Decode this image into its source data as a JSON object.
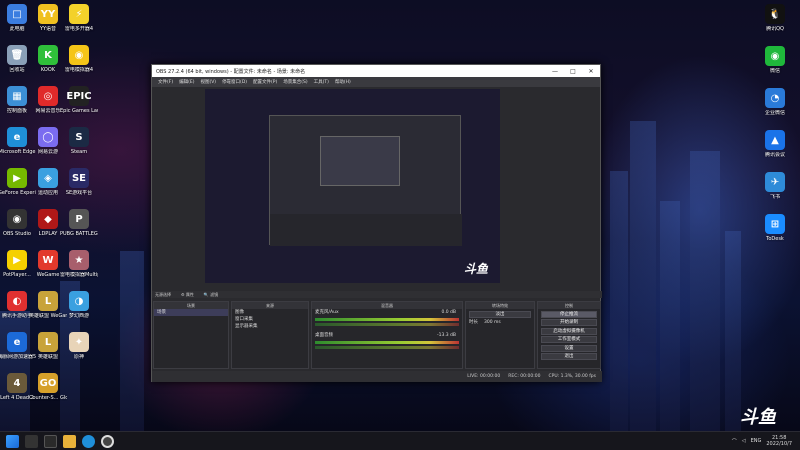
{
  "desktop_left": [
    {
      "name": "this-pc-icon",
      "label": "此电脑",
      "color": "#3b7de0",
      "glyph": "□"
    },
    {
      "name": "yy-voice-icon",
      "label": "YY语音",
      "color": "#f0c020",
      "glyph": "YY"
    },
    {
      "name": "thunder-icon",
      "label": "雷电多开器4",
      "color": "#f3d12a",
      "glyph": "⚡"
    },
    {
      "name": "recycle-bin-icon",
      "label": "回收站",
      "color": "#8aa0b8",
      "glyph": "🗑"
    },
    {
      "name": "kook-icon",
      "label": "KOOK",
      "color": "#2fbf3a",
      "glyph": "K"
    },
    {
      "name": "ldplayer-icon",
      "label": "雷电模拟器4",
      "color": "#f5c518",
      "glyph": "◉"
    },
    {
      "name": "control-panel-icon",
      "label": "控制面板",
      "color": "#3c8fd6",
      "glyph": "▦"
    },
    {
      "name": "netease-music-icon",
      "label": "网易云音乐",
      "color": "#e02a2a",
      "glyph": "◎"
    },
    {
      "name": "epic-games-icon",
      "label": "Epic Games Launcher",
      "color": "#222",
      "glyph": "EPIC"
    },
    {
      "name": "edge-icon",
      "label": "Microsoft Edge",
      "color": "#1f8fd8",
      "glyph": "e"
    },
    {
      "name": "cloud-icon",
      "label": "网易云游",
      "color": "#7b6cf0",
      "glyph": "◯"
    },
    {
      "name": "steam-icon",
      "label": "Steam",
      "color": "#1b2a44",
      "glyph": "S"
    },
    {
      "name": "geforce-icon",
      "label": "GeForce Experience",
      "color": "#76b900",
      "glyph": "▶"
    },
    {
      "name": "app-icon",
      "label": "运动应用",
      "color": "#3aa0e0",
      "glyph": "◈"
    },
    {
      "name": "se-icon",
      "label": "SE游戏平台",
      "color": "#2a2a66",
      "glyph": "SE"
    },
    {
      "name": "obs-icon",
      "label": "OBS Studio",
      "color": "#333",
      "glyph": "◉"
    },
    {
      "name": "ldplay-icon",
      "label": "LDPLAY",
      "color": "#b01818",
      "glyph": "◆"
    },
    {
      "name": "pubg-icon",
      "label": "PUBG BATTLEG...",
      "color": "#555",
      "glyph": "P"
    },
    {
      "name": "potplayer-icon",
      "label": "PotPlayer...",
      "color": "#f5d000",
      "glyph": "▶"
    },
    {
      "name": "wegame-icon",
      "label": "WeGame",
      "color": "#e2392c",
      "glyph": "W"
    },
    {
      "name": "anime-icon",
      "label": "雷电模拟器Multipla...",
      "color": "#a85e6c",
      "glyph": "★"
    },
    {
      "name": "tencent-emu-icon",
      "label": "腾讯手游助手",
      "color": "#e03030",
      "glyph": "◐"
    },
    {
      "name": "lol-icon",
      "label": "英雄联盟 WeGame版",
      "color": "#c8a33a",
      "glyph": "L"
    },
    {
      "name": "game-center-icon",
      "label": "梦幻西游",
      "color": "#3aa0e0",
      "glyph": "◑"
    },
    {
      "name": "network-icon",
      "label": "海豚网游加速器5.0",
      "color": "#1c6ad8",
      "glyph": "e"
    },
    {
      "name": "lol2-icon",
      "label": "英雄联盟",
      "color": "#c8a33a",
      "glyph": "L"
    },
    {
      "name": "genshin-icon",
      "label": "原神",
      "color": "#e8d4b8",
      "glyph": "✦"
    },
    {
      "name": "l4d2-icon",
      "label": "Left 4 Dead 2",
      "color": "#6b5a3a",
      "glyph": "4"
    },
    {
      "name": "csgo-icon",
      "label": "Counter-S... Global Off...",
      "color": "#d6a02a",
      "glyph": "GO"
    }
  ],
  "desktop_right": [
    {
      "name": "qq-icon",
      "label": "腾讯QQ",
      "color": "#111",
      "glyph": "🐧"
    },
    {
      "name": "wechat-icon",
      "label": "微信",
      "color": "#1fb83b",
      "glyph": "◉"
    },
    {
      "name": "enterprise-icon",
      "label": "企业微信",
      "color": "#2a7ad8",
      "glyph": "◔"
    },
    {
      "name": "tencent-meeting-icon",
      "label": "腾讯会议",
      "color": "#1a73e8",
      "glyph": "▲"
    },
    {
      "name": "feishu-icon",
      "label": "飞书",
      "color": "#2e8bd8",
      "glyph": "✈"
    },
    {
      "name": "todesk-icon",
      "label": "ToDesk",
      "color": "#1a8cff",
      "glyph": "⊞"
    }
  ],
  "obs": {
    "title": "OBS 27.2.4 (64 bit, windows) - 配置文件: 未命名 - 场景: 未命名",
    "controls": [
      "—",
      "□",
      "✕"
    ],
    "menu": [
      "文件(F)",
      "编辑(E)",
      "视图(V)",
      "停靠窗口(D)",
      "配置文件(P)",
      "场景集合(S)",
      "工具(T)",
      "帮助(H)"
    ],
    "preview_logo": "斗鱼",
    "status_bar": [
      "无源选择",
      "⚙ 属性",
      "🔍 滤镜"
    ],
    "scenes": {
      "header": "场景",
      "items": [
        "场景"
      ]
    },
    "sources": {
      "header": "来源",
      "items": [
        "图像",
        "窗口采集",
        "显示器采集"
      ]
    },
    "mixer": {
      "header": "混音器",
      "tracks": [
        {
          "name": "麦克风/Aux",
          "db": "0.0 dB"
        },
        {
          "name": "桌面音频",
          "db": "-13.3 dB"
        }
      ]
    },
    "transitions": {
      "header": "转场特效",
      "type": "淡出",
      "duration_label": "时长",
      "duration": "300 ms"
    },
    "controls_dock": {
      "header": "控制",
      "buttons": [
        "停止推流",
        "开始录制",
        "启动虚拟摄像机",
        "工作室模式",
        "设置",
        "退出"
      ]
    },
    "statusbar": [
      "LIVE: 00:00:00",
      "REC: 00:00:00",
      "CPU: 1.3%, 30.00 fps"
    ]
  },
  "taskbar": {
    "lang": "ENG",
    "time": "21:58",
    "date": "2022/10/7",
    "icons": [
      "windows-icon",
      "search-icon",
      "task-view-icon",
      "folder-icon",
      "edge-icon",
      "obs-icon"
    ]
  },
  "watermark": "斗鱼"
}
